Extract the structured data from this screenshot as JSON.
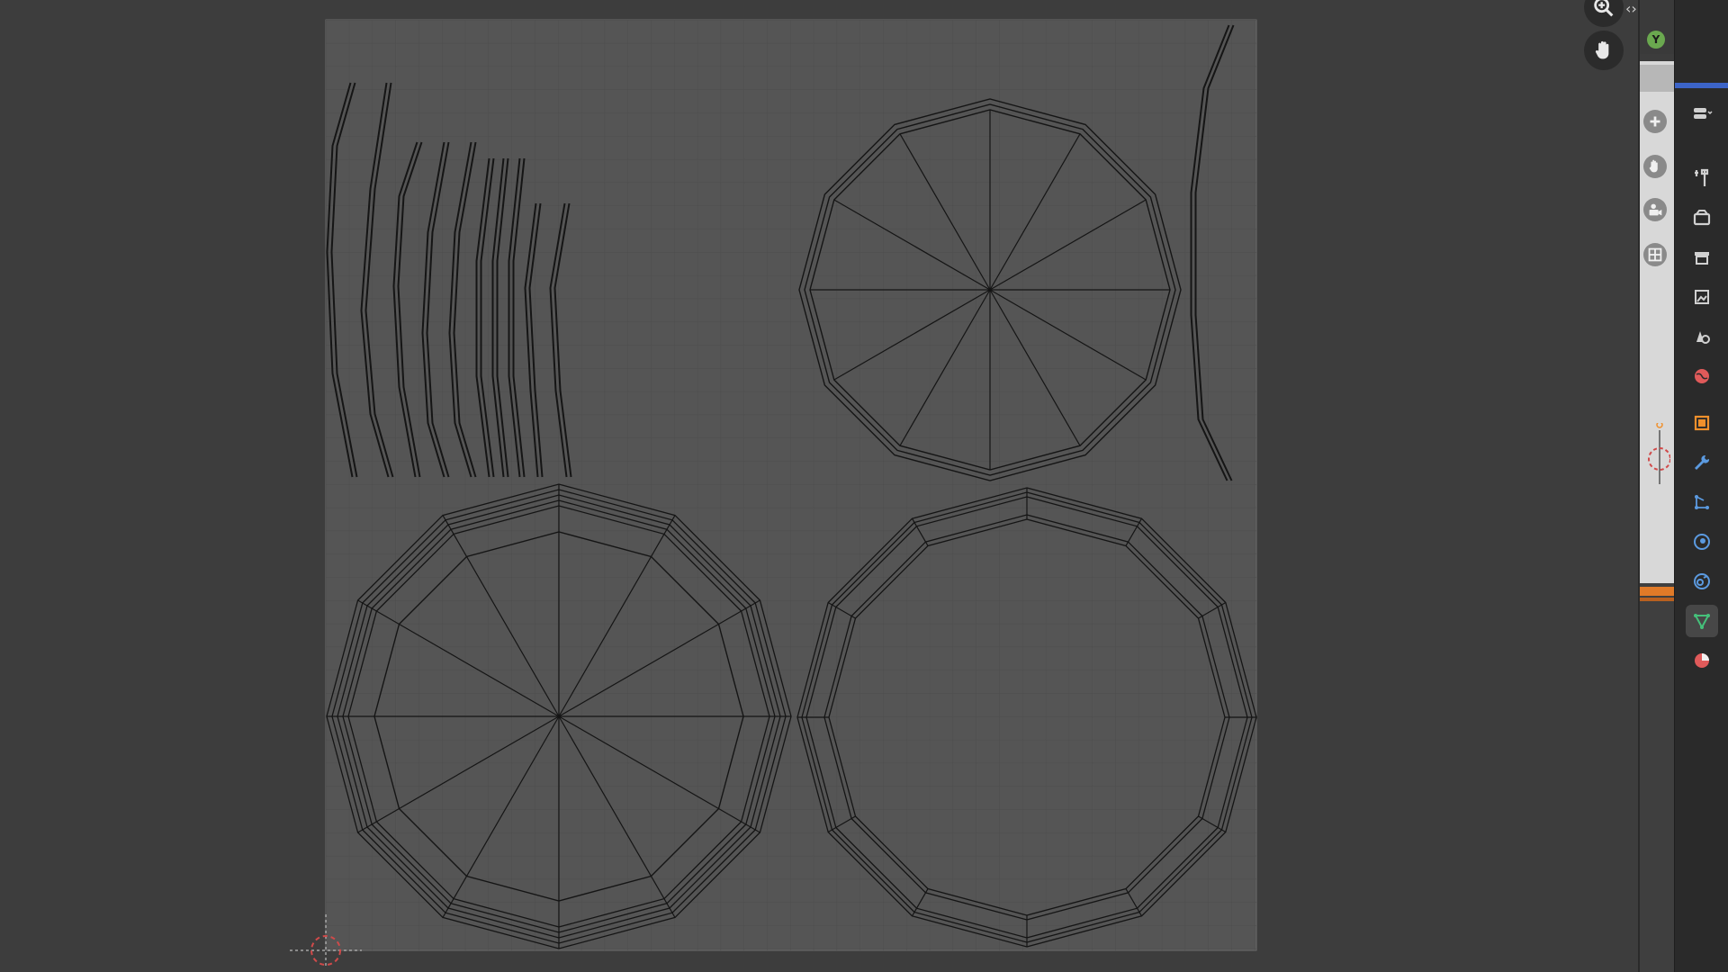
{
  "editor": {
    "name": "UV Editor"
  },
  "gizmos": [
    {
      "name": "zoom-icon"
    },
    {
      "name": "pan-hand-icon"
    }
  ],
  "viewport_strip": {
    "axis_label": "Y",
    "axis_color": "#6aa84f",
    "tools": [
      "add-icon",
      "hand-icon",
      "camera-icon",
      "grid-icon"
    ]
  },
  "properties_tabs": [
    {
      "name": "tool-icon",
      "color": "#d0d0d0"
    },
    {
      "name": "render-icon",
      "color": "#d0d0d0"
    },
    {
      "name": "output-icon",
      "color": "#d0d0d0"
    },
    {
      "name": "view-layer-icon",
      "color": "#d0d0d0"
    },
    {
      "name": "scene-icon",
      "color": "#d0d0d0"
    },
    {
      "name": "world-icon",
      "color": "#e05a5a"
    },
    {
      "name": "object-icon",
      "color": "#f0902c"
    },
    {
      "name": "modifier-icon",
      "color": "#5b9ae0"
    },
    {
      "name": "particles-icon",
      "color": "#5b9ae0"
    },
    {
      "name": "physics-icon",
      "color": "#5b9ae0"
    },
    {
      "name": "constraints-icon",
      "color": "#5b9ae0"
    },
    {
      "name": "data-icon",
      "color": "#45c07a",
      "active": true
    },
    {
      "name": "material-icon",
      "color": "#e05a5a"
    }
  ],
  "colors": {
    "background": "#3d3d3d",
    "uv_grid": "#545454",
    "uv_lines": "#151515",
    "cursor": "#d04a4a",
    "accent_blue": "#3c64c8"
  }
}
